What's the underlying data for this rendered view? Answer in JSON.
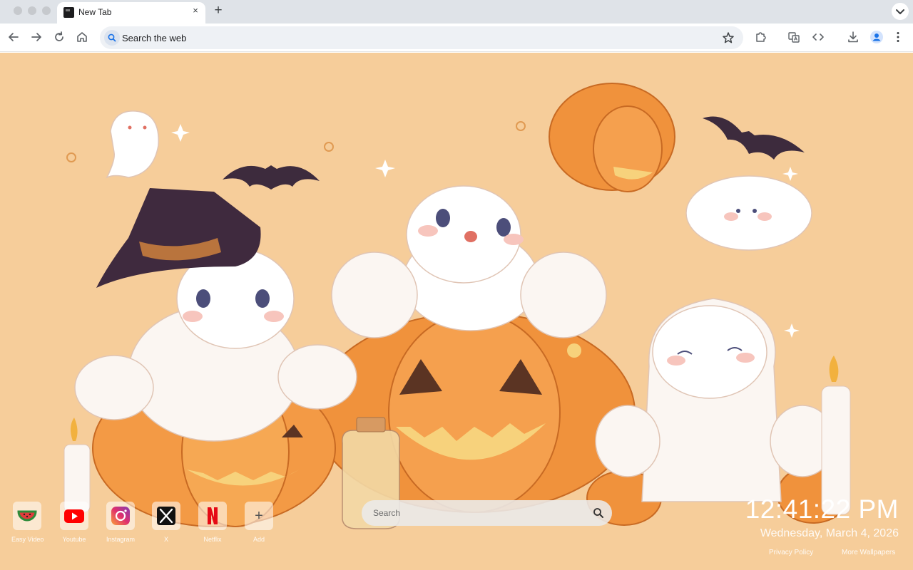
{
  "tab": {
    "title": "New Tab",
    "close_glyph": "×"
  },
  "toolbar": {
    "new_tab_glyph": "+",
    "omnibox_placeholder": "Search the web"
  },
  "shortcuts": [
    {
      "label": "Easy Video"
    },
    {
      "label": "Youtube"
    },
    {
      "label": "Instagram"
    },
    {
      "label": "X"
    },
    {
      "label": "Netflix"
    },
    {
      "label": "Add",
      "glyph": "+"
    }
  ],
  "search": {
    "placeholder": "Search"
  },
  "clock": {
    "time": "12:41:22 PM",
    "date": "Wednesday, March 4, 2026"
  },
  "footer": {
    "privacy": "Privacy Policy",
    "more": "More Wallpapers"
  },
  "colors": {
    "background": "#f6cd9a",
    "pumpkin": "#f0923c",
    "accent": "#e47a2a"
  }
}
